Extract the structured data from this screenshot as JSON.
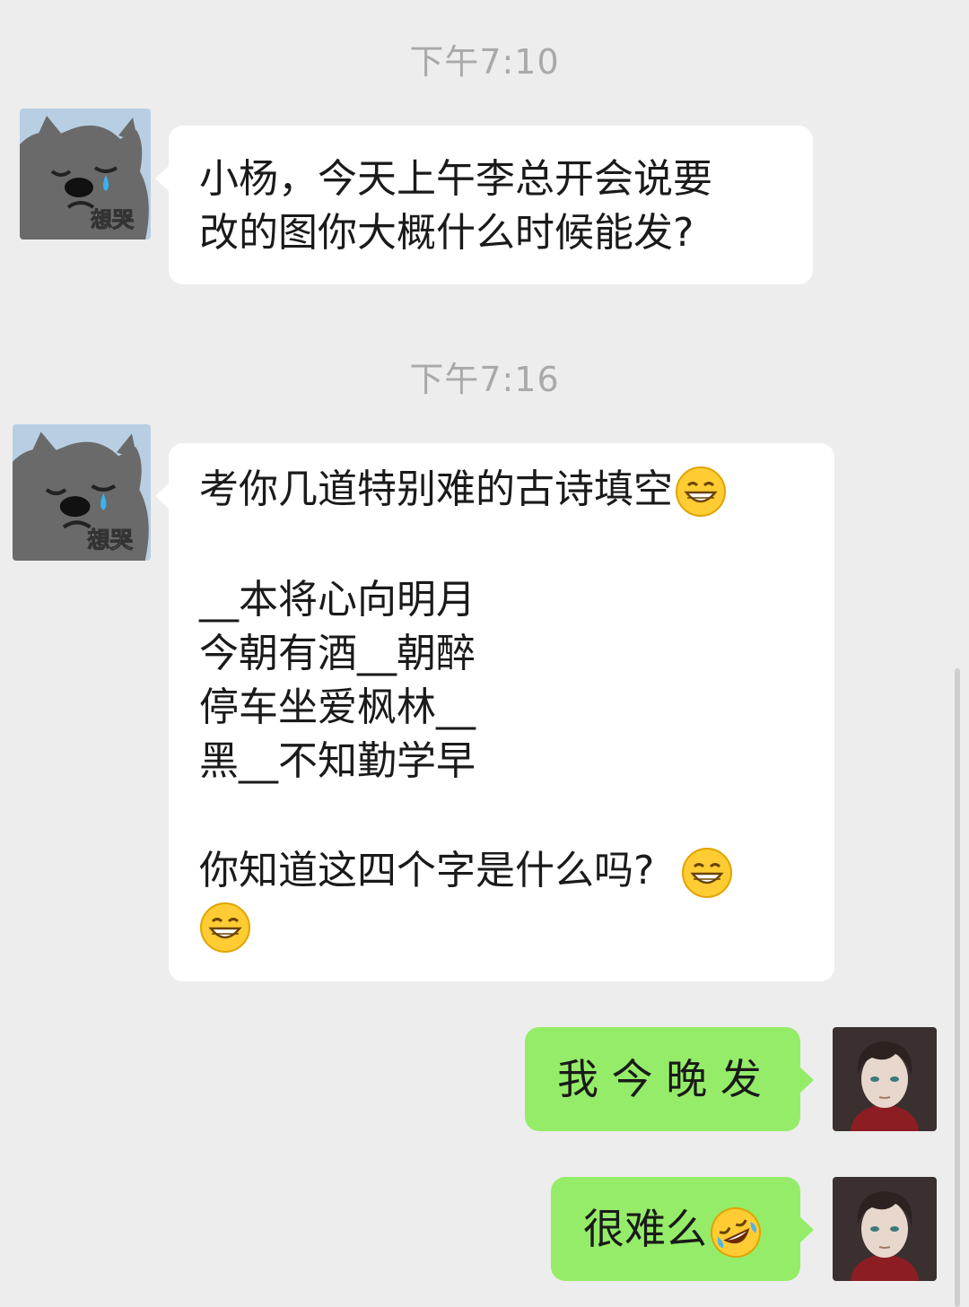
{
  "messages": [
    {
      "type": "time",
      "text": "下午7:10"
    },
    {
      "type": "incoming",
      "sender": "想哭",
      "lines": [
        "小杨，今天上午李总开会说要",
        "改的图你大概什么时候能发?"
      ]
    },
    {
      "type": "time",
      "text": "下午7:16"
    },
    {
      "type": "incoming",
      "sender": "想哭",
      "intro": "考你几道特别难的古诗填空",
      "poem": [
        "__本将心向明月",
        "今朝有酒__朝醉",
        "停车坐爱枫林__",
        "黑__不知勤学早"
      ],
      "question": "你知道这四个字是什么吗?"
    },
    {
      "type": "outgoing",
      "text": "我 今 晚 发"
    },
    {
      "type": "outgoing",
      "text": "很难么"
    }
  ],
  "emojis": {
    "grin": "grinning-face-emoji",
    "laugh_cry": "rolling-laughing-emoji"
  },
  "avatar_badge": "想哭",
  "colors": {
    "background": "#ededed",
    "incoming_bubble": "#ffffff",
    "outgoing_bubble": "#95ec69",
    "timestamp": "#a9a9a9"
  }
}
